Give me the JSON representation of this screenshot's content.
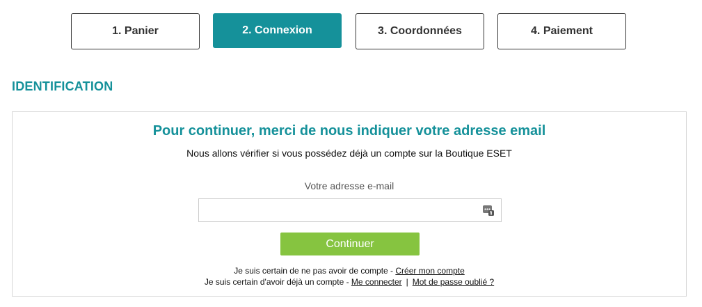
{
  "steps": [
    {
      "label": "1. Panier",
      "active": false
    },
    {
      "label": "2. Connexion",
      "active": true
    },
    {
      "label": "3. Coordonnées",
      "active": false
    },
    {
      "label": "4. Paiement",
      "active": false
    }
  ],
  "section": {
    "title": "IDENTIFICATION"
  },
  "panel": {
    "heading": "Pour continuer, merci de nous indiquer votre adresse email",
    "subheading": "Nous allons vérifier si vous possédez déjà un compte sur la Boutique ESET",
    "email_label": "Votre adresse e-mail",
    "email_value": "",
    "email_placeholder": "",
    "continue_label": "Continuer"
  },
  "links": {
    "no_account_text": "Je suis certain de ne pas avoir de compte - ",
    "create_account": "Créer mon compte",
    "has_account_text": "Je suis certain d'avoir déjà un compte - ",
    "login": "Me connecter",
    "separator": "|",
    "forgot_password": "Mot de passe oublié ?"
  },
  "colors": {
    "accent": "#15919a",
    "button": "#86c440",
    "border": "#d6d6d6"
  },
  "icons": {
    "email_field": "password-manager-icon"
  }
}
